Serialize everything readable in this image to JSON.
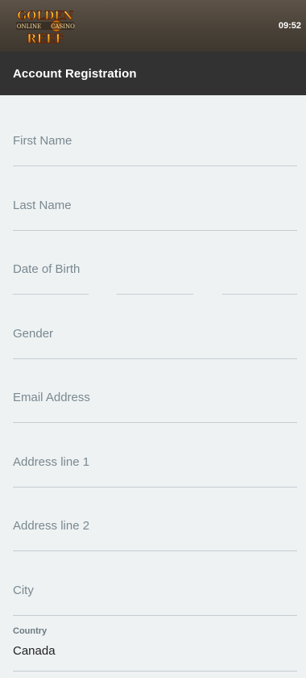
{
  "status_bar": {
    "time": "09:52"
  },
  "brand": {
    "line1": "GOLDEN",
    "line2_left": "ONLINE",
    "line2_right": "CASINO",
    "line3": "REEF"
  },
  "header": {
    "title": "Account Registration"
  },
  "form": {
    "first_name": {
      "placeholder": "First Name",
      "value": ""
    },
    "last_name": {
      "placeholder": "Last Name",
      "value": ""
    },
    "date_of_birth": {
      "placeholder": "Date of Birth",
      "value": ""
    },
    "gender": {
      "placeholder": "Gender",
      "value": ""
    },
    "email": {
      "placeholder": "Email Address",
      "value": ""
    },
    "address_line_1": {
      "placeholder": "Address line 1",
      "value": ""
    },
    "address_line_2": {
      "placeholder": "Address line 2",
      "value": ""
    },
    "city": {
      "placeholder": "City",
      "value": ""
    },
    "country": {
      "label": "Country",
      "value": "Canada"
    }
  },
  "colors": {
    "topbar": "#4a4238",
    "header": "#333232",
    "background": "#eef2f3",
    "placeholder": "#7a8890",
    "divider": "#c5cdd1"
  }
}
